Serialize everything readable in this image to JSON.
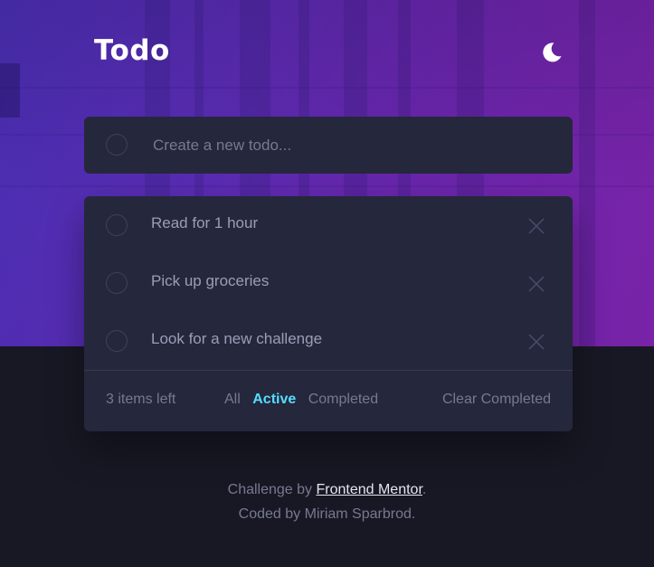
{
  "header": {
    "title": "Todo",
    "theme_icon": "moon-icon"
  },
  "new_todo": {
    "placeholder": "Create a new todo...",
    "value": ""
  },
  "todos": [
    {
      "text": "Read for 1 hour",
      "completed": false
    },
    {
      "text": "Pick up groceries",
      "completed": false
    },
    {
      "text": "Look for a new challenge",
      "completed": false
    }
  ],
  "footer": {
    "items_left": "3 items left",
    "filters": [
      {
        "label": "All",
        "active": false
      },
      {
        "label": "Active",
        "active": true
      },
      {
        "label": "Completed",
        "active": false
      }
    ],
    "clear_label": "Clear Completed"
  },
  "attribution": {
    "prefix": "Challenge by ",
    "link_text": "Frontend Mentor",
    "suffix": ".",
    "line2": "Coded by Miriam Sparbrod."
  },
  "colors": {
    "active_filter": "#55ddff",
    "card_bg": "#25273c",
    "page_bg": "#181824"
  }
}
